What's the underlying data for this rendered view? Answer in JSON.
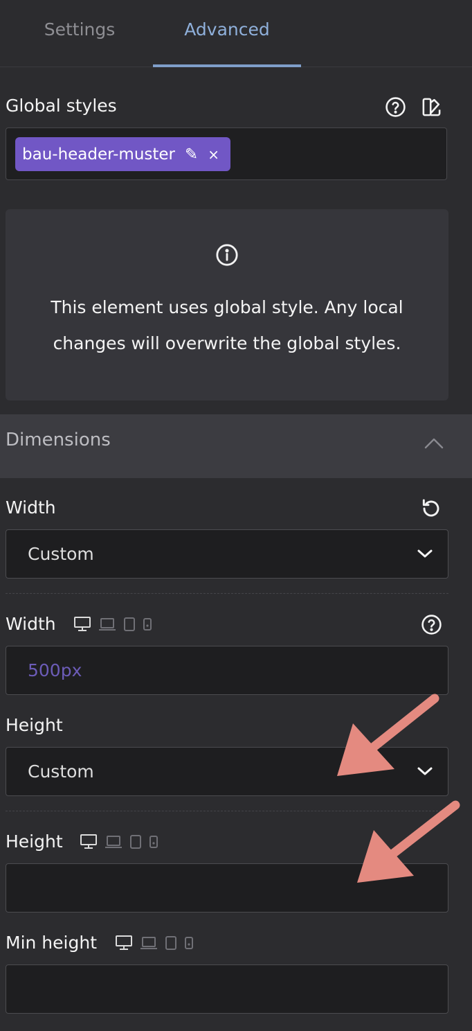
{
  "tabs": {
    "settings": "Settings",
    "advanced": "Advanced"
  },
  "global_styles": {
    "label": "Global styles",
    "chip_label": "bau-header-muster",
    "chip_edit_glyph": "✎",
    "chip_remove_glyph": "×",
    "notice_line1": "This element uses global style. Any local",
    "notice_line2": "changes will overwrite the global styles."
  },
  "dimensions": {
    "title": "Dimensions",
    "width_mode_label": "Width",
    "width_mode_value": "Custom",
    "width_label": "Width",
    "width_value": "500px",
    "height_mode_label": "Height",
    "height_mode_value": "Custom",
    "height_label": "Height",
    "height_value": "",
    "min_height_label": "Min height",
    "min_height_value": ""
  },
  "colors": {
    "accent": "#8fb0db",
    "chip": "#7157c5",
    "value_text": "#6c5cb8",
    "annotation_arrow": "#e48a80"
  },
  "icons": [
    "help-circle-icon",
    "style-panel-icon",
    "info-icon",
    "chevron-up-icon",
    "reset-icon",
    "chevron-down-icon",
    "desktop-icon",
    "laptop-icon",
    "tablet-icon",
    "mobile-icon"
  ]
}
